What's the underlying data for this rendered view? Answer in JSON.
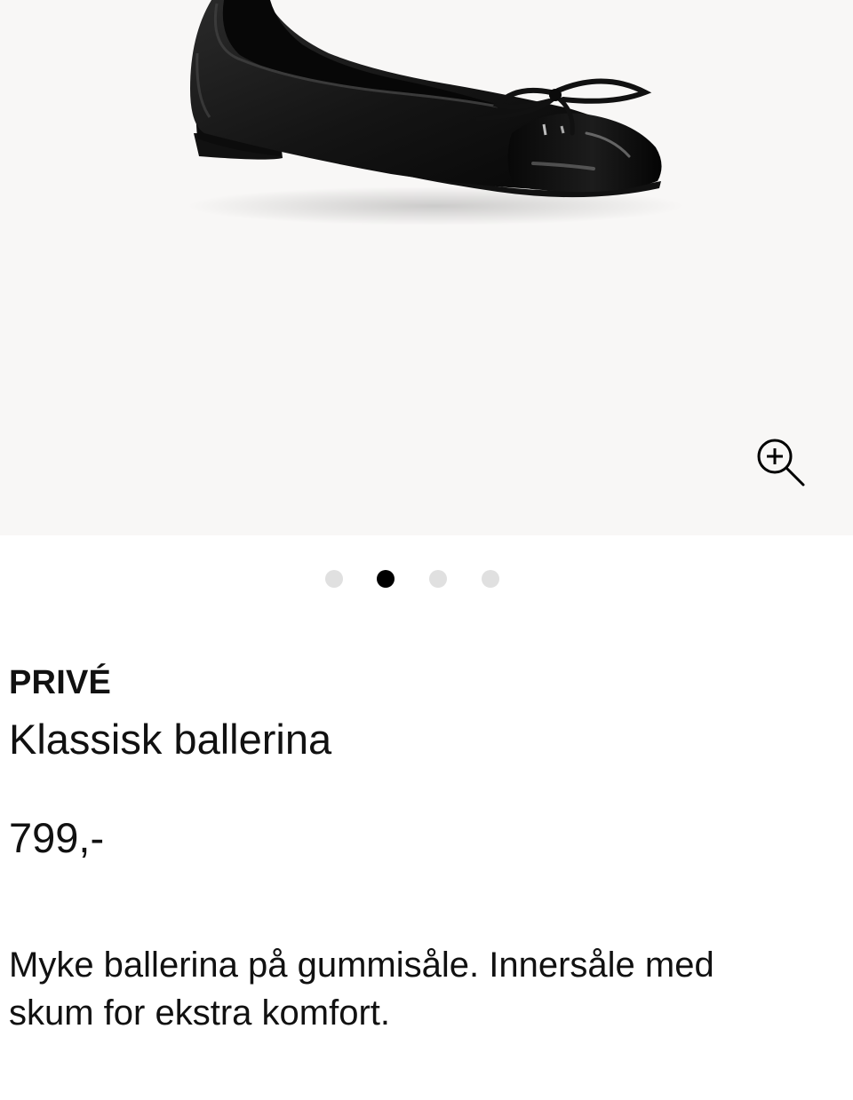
{
  "gallery": {
    "image_alt": "Black leather ballerina flat with patent toe cap and bow",
    "zoom_icon": "zoom-in-icon",
    "dots_count": 4,
    "active_index": 1
  },
  "product": {
    "brand": "PRIVÉ",
    "name": "Klassisk ballerina",
    "price": "799,-",
    "description_lines": [
      "Myke ballerina på gummisåle. Innersåle med",
      "skum for ekstra komfort."
    ]
  },
  "colors": {
    "gallery_background": "#f8f7f6",
    "dot_inactive": "#e0e0e0",
    "dot_active": "#000000",
    "text": "#111111"
  }
}
